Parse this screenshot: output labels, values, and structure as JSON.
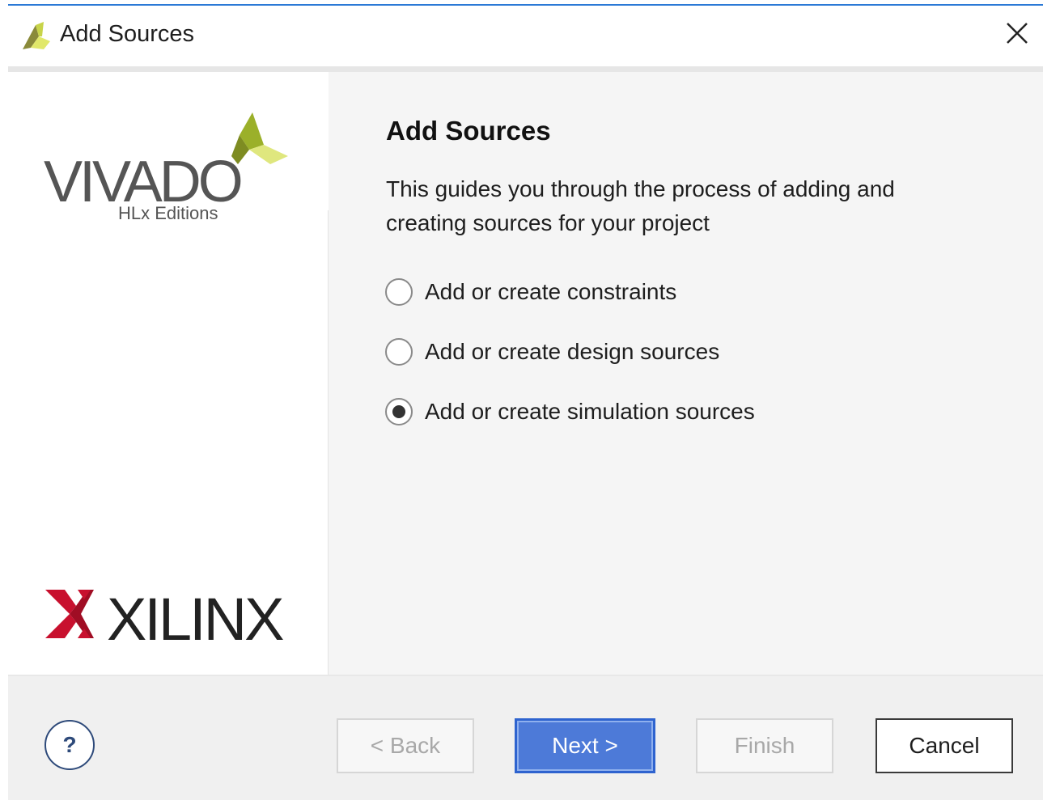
{
  "window": {
    "title": "Add Sources",
    "app_icon": "vivado-leaf-icon",
    "close_icon": "close-icon"
  },
  "branding": {
    "product_logo_text": "VIVADO",
    "product_edition": "HLx Editions",
    "company_logo_text": "XILINX"
  },
  "page": {
    "heading": "Add Sources",
    "description": "This guides you through the process of adding and creating sources for your project"
  },
  "options": [
    {
      "label": "Add or create constraints",
      "selected": false
    },
    {
      "label": "Add or create design sources",
      "selected": false
    },
    {
      "label": "Add or create simulation sources",
      "selected": true
    }
  ],
  "buttons": {
    "help": "?",
    "back": "< Back",
    "next": "Next >",
    "finish": "Finish",
    "cancel": "Cancel"
  },
  "colors": {
    "accent": "#2e63cf",
    "logo_green": "#b5cc3a",
    "xilinx_red": "#c8102e",
    "window_border": "#2b79d6"
  }
}
